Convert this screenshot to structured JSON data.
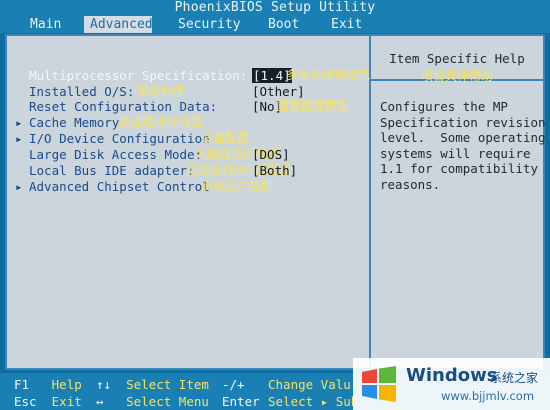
{
  "title": "PhoenixBIOS Setup Utility",
  "menu": [
    {
      "label": "Main"
    },
    {
      "label": "Advanced",
      "active": true
    },
    {
      "label": "Security"
    },
    {
      "label": "Boot"
    },
    {
      "label": "Exit"
    }
  ],
  "settings": [
    {
      "label": "Multiprocessor Specification:",
      "value": "[1.4]",
      "selected": true,
      "annotation": "多重处理器规范",
      "highlight": true
    },
    {
      "label": "Installed O/S:",
      "value": "[Other]",
      "annotation": "安装程序"
    },
    {
      "label": "Reset Configuration Data:",
      "value": "[No]",
      "annotation": "重置配置数据"
    },
    {
      "label": "Cache Memory",
      "submenu": true,
      "annotation": "高速缓冲存储器"
    },
    {
      "label": "I/O Device Configuration",
      "submenu": true,
      "annotation": "设备配置"
    },
    {
      "label": "Large Disk Access Mode:",
      "value": "[DOS]",
      "annotation": "大磁盘访问模式"
    },
    {
      "label": "Local Bus IDE adapter:",
      "value": "[Both]",
      "annotation": "局部总线IDE适配器"
    },
    {
      "label": "Advanced Chipset Control",
      "submenu": true,
      "annotation": "高级芯片控制"
    }
  ],
  "help": {
    "title": "Item Specific Help",
    "title_annotation": "项目具体帮助",
    "text": "Configures the MP\nSpecification revision\nlevel.  Some operating\nsystems will require\n1.1 for compatibility\nreasons."
  },
  "footer": [
    [
      {
        "key": "F1",
        "desc": "Help"
      },
      {
        "key": "↑↓",
        "desc": "Select Item"
      },
      {
        "key": "-/+",
        "desc": ""
      },
      {
        "key": "",
        "desc": "Change Valu"
      }
    ],
    [
      {
        "key": "Esc",
        "desc": "Exit"
      },
      {
        "key": "↔",
        "desc": "Select Menu"
      },
      {
        "key": "Enter",
        "desc": ""
      },
      {
        "key": "",
        "desc": "Select ▸ Sub"
      }
    ]
  ],
  "watermark": {
    "title": "Windows",
    "subtitle": "系统之家",
    "url": "www.bjjmlv.com"
  },
  "colors": {
    "background": "#0b6fa3",
    "panel": "#ccd4dc",
    "annotation": "#f2e36a",
    "text_blue": "#1c4a8a"
  }
}
